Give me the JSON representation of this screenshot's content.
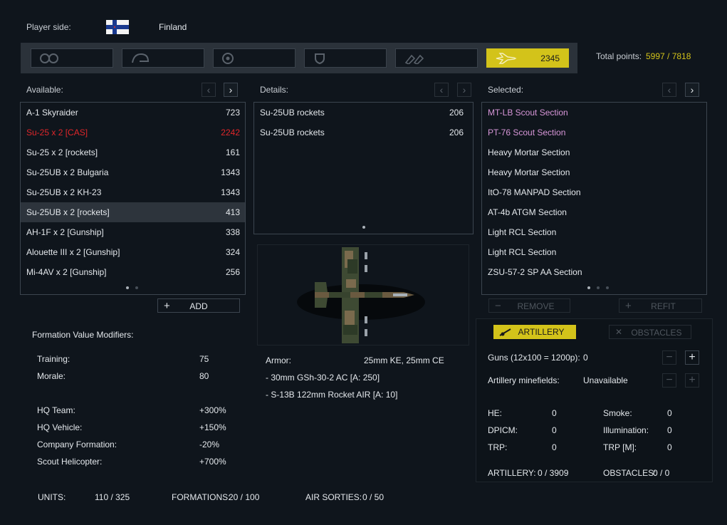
{
  "player": {
    "label": "Player side:",
    "country": "Finland"
  },
  "categories": [
    {
      "icon": "recon-icon",
      "value": ""
    },
    {
      "icon": "infantry-helmet-icon",
      "value": ""
    },
    {
      "icon": "support-target-icon",
      "value": ""
    },
    {
      "icon": "shield-icon",
      "value": ""
    },
    {
      "icon": "ammo-icon",
      "value": ""
    },
    {
      "icon": "aircraft-icon",
      "value": "2345"
    }
  ],
  "total": {
    "label": "Total points:",
    "value": "5997 / 7818"
  },
  "available": {
    "label": "Available:",
    "items": [
      {
        "name": "A-1 Skyraider",
        "cost": "723"
      },
      {
        "name": "Su-25 x 2 [CAS]",
        "cost": "2242"
      },
      {
        "name": "Su-25 x 2 [rockets]",
        "cost": "161"
      },
      {
        "name": "Su-25UB x 2 Bulgaria",
        "cost": "1343"
      },
      {
        "name": "Su-25UB x 2 KH-23",
        "cost": "1343"
      },
      {
        "name": "Su-25UB x 2 [rockets]",
        "cost": "413"
      },
      {
        "name": "AH-1F x 2 [Gunship]",
        "cost": "338"
      },
      {
        "name": "Alouette III x 2 [Gunship]",
        "cost": "324"
      },
      {
        "name": "Mi-4AV x 2 [Gunship]",
        "cost": "256"
      }
    ],
    "add_label": "ADD"
  },
  "details": {
    "label": "Details:",
    "items": [
      {
        "name": "Su-25UB rockets",
        "cost": "206"
      },
      {
        "name": "Su-25UB rockets",
        "cost": "206"
      }
    ],
    "armor_label": "Armor:",
    "armor_value": "25mm KE, 25mm CE",
    "weapons": [
      "- 30mm GSh-30-2 AC [A: 250]",
      "- S-13B 122mm Rocket AIR [A: 10]"
    ]
  },
  "selected": {
    "label": "Selected:",
    "items": [
      {
        "name": "MT-LB Scout Section"
      },
      {
        "name": "PT-76 Scout Section"
      },
      {
        "name": "Heavy Mortar Section"
      },
      {
        "name": "Heavy Mortar Section"
      },
      {
        "name": "ItO-78 MANPAD Section"
      },
      {
        "name": "AT-4b ATGM Section"
      },
      {
        "name": "Light RCL Section"
      },
      {
        "name": "Light RCL Section"
      },
      {
        "name": "ZSU-57-2 SP AA Section"
      }
    ],
    "remove_label": "REMOVE",
    "refit_label": "REFIT"
  },
  "modifiers": {
    "title": "Formation Value Modifiers:",
    "rows": [
      {
        "label": "Training:",
        "value": "75"
      },
      {
        "label": "Morale:",
        "value": "80"
      },
      {
        "label": "HQ Team:",
        "value": "+300%"
      },
      {
        "label": "HQ Vehicle:",
        "value": "+150%"
      },
      {
        "label": "Company Formation:",
        "value": "-20%"
      },
      {
        "label": "Scout Helicopter:",
        "value": "+700%"
      }
    ]
  },
  "footer": {
    "units_label": "UNITS:",
    "units_value": "110 / 325",
    "formations_label": "FORMATIONS:",
    "formations_value": "20 / 100",
    "sorties_label": "AIR SORTIES:",
    "sorties_value": "0 / 50"
  },
  "artillery": {
    "tab_label": "ARTILLERY",
    "obstacles_tab_label": "OBSTACLES",
    "guns_label": "Guns (12x100 = 1200p):",
    "guns_value": "0",
    "minefields_label": "Artillery minefields:",
    "minefields_value": "Unavailable",
    "he_label": "HE:",
    "he_value": "0",
    "smoke_label": "Smoke:",
    "smoke_value": "0",
    "dpicm_label": "DPICM:",
    "dpicm_value": "0",
    "illum_label": "Illumination:",
    "illum_value": "0",
    "trp_label": "TRP:",
    "trp_value": "0",
    "trpm_label": "TRP [M]:",
    "trpm_value": "0",
    "total_label": "ARTILLERY:",
    "total_value": "0 / 3909",
    "obstacles_label": "OBSTACLES:",
    "obstacles_value": "0 / 0"
  },
  "colors": {
    "accent": "#d3c31a",
    "warning": "#e0262a",
    "recon": "#d796d8"
  }
}
